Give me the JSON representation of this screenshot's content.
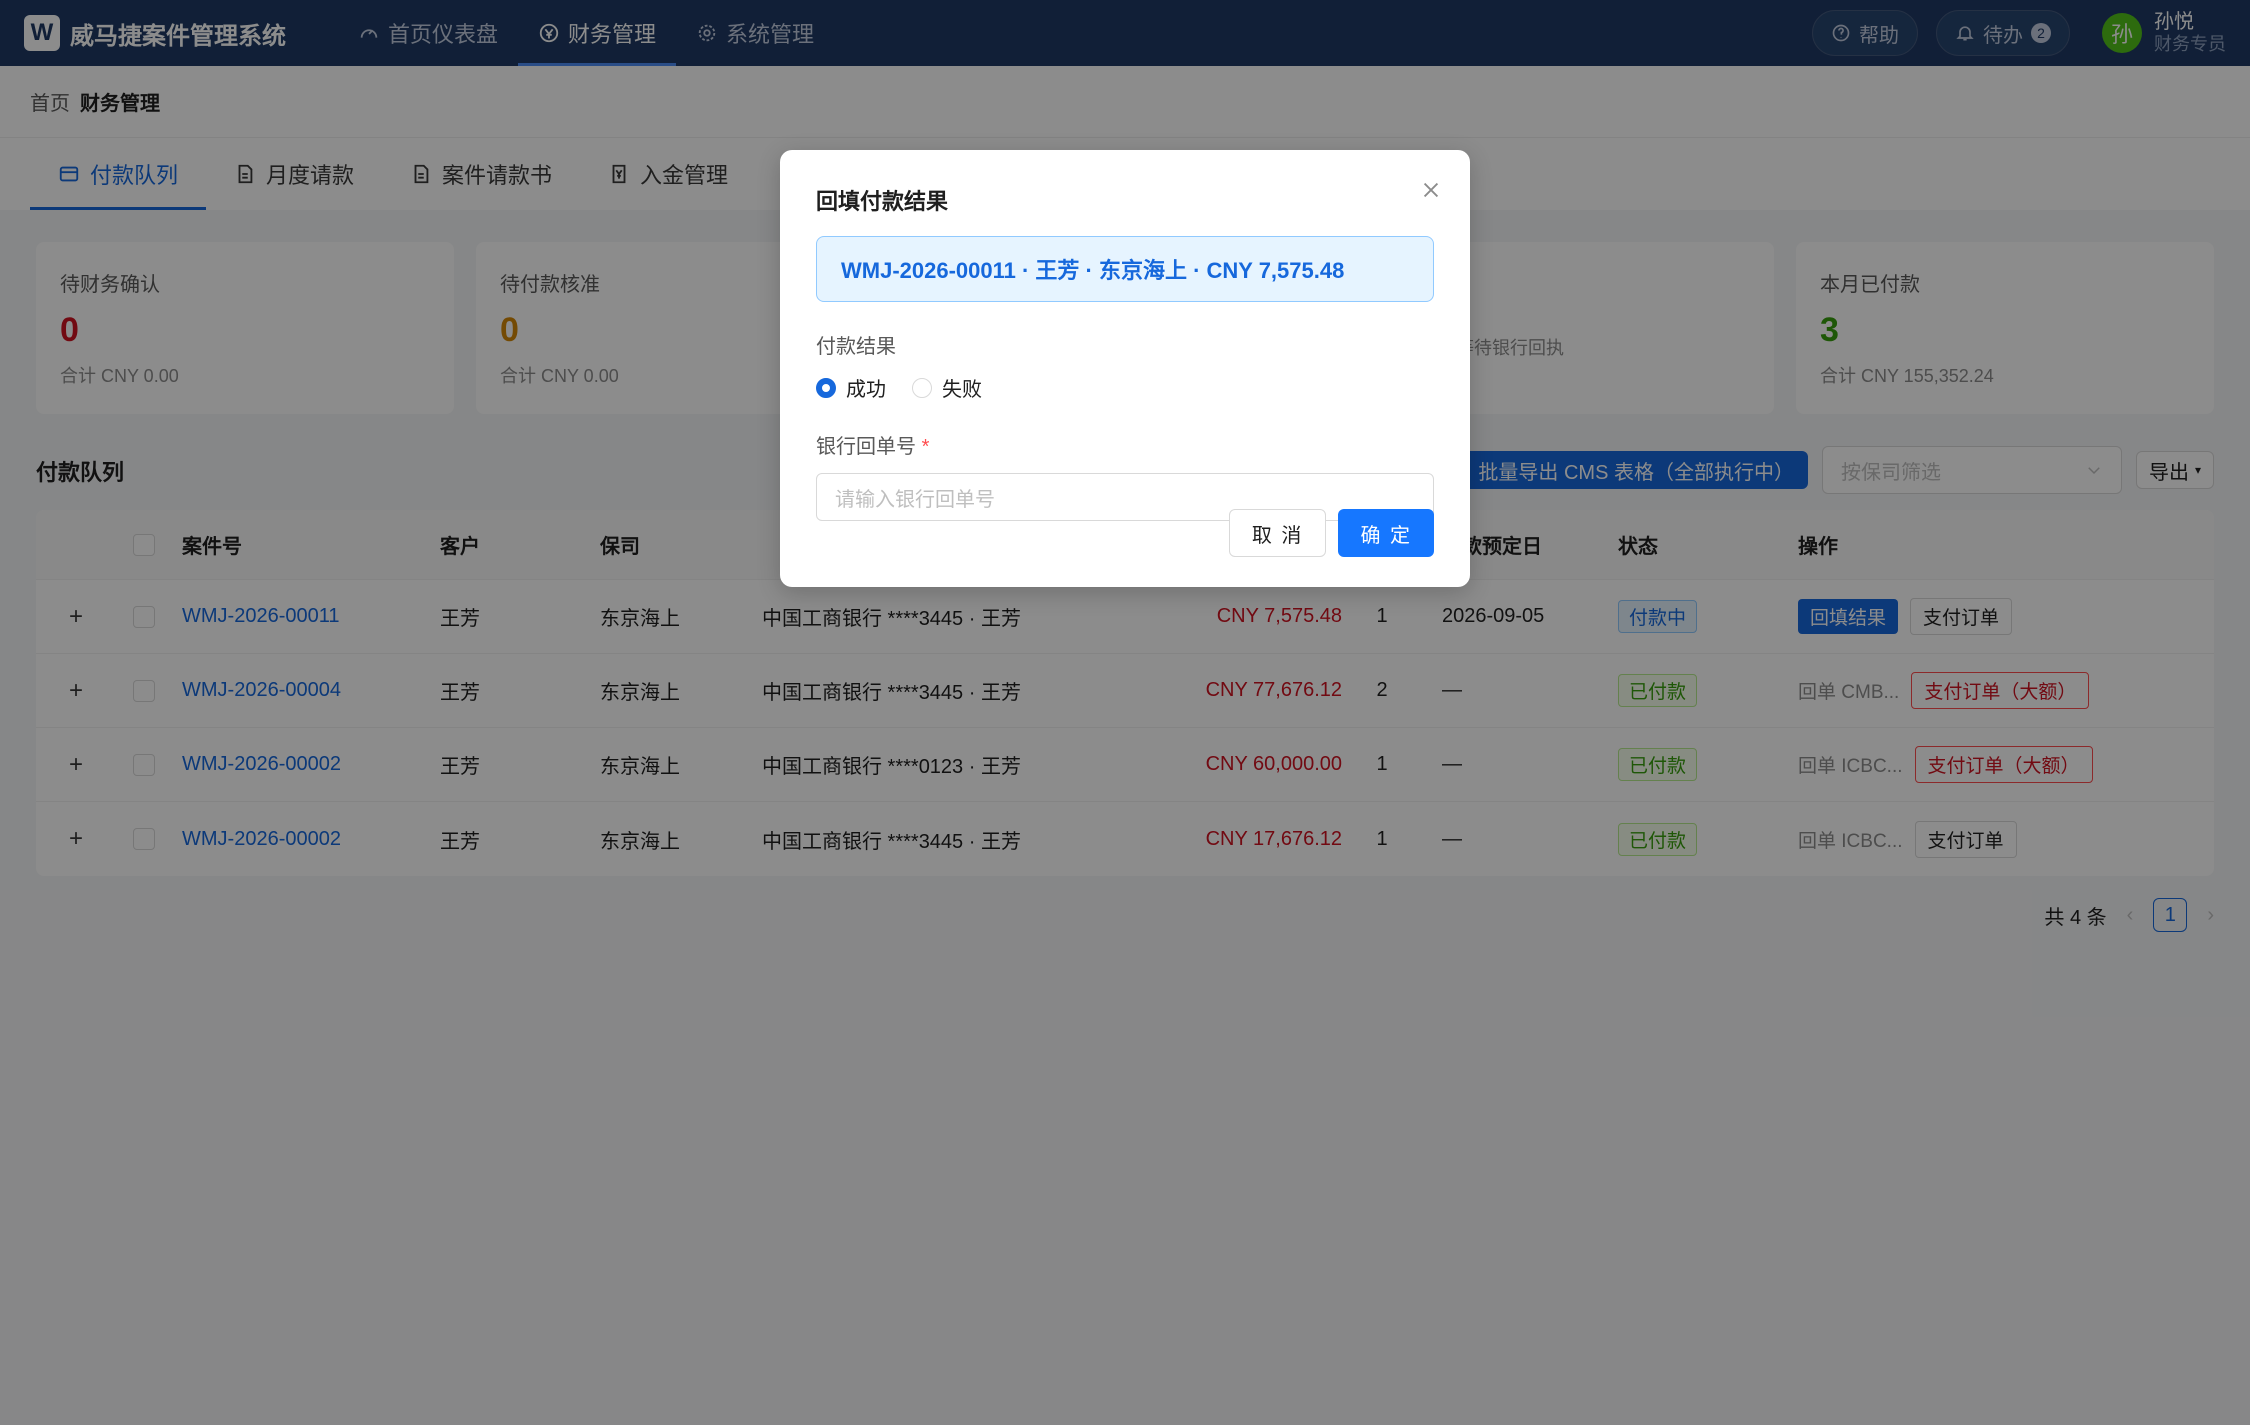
{
  "app": {
    "logo_letter": "W",
    "title": "威马捷案件管理系统"
  },
  "nav": [
    {
      "label": "首页仪表盘",
      "icon": "dashboard-icon"
    },
    {
      "label": "财务管理",
      "icon": "finance-icon"
    },
    {
      "label": "系统管理",
      "icon": "gear-icon"
    }
  ],
  "topbar": {
    "help": "帮助",
    "todo": "待办",
    "todo_count": "2"
  },
  "user": {
    "avatar": "孙",
    "name": "孙悦",
    "role": "财务专员"
  },
  "breadcrumb": {
    "home": "首页",
    "current": "财务管理"
  },
  "subtabs": [
    "付款队列",
    "月度请款",
    "案件请款书",
    "入金管理"
  ],
  "stats": [
    {
      "label": "待财务确认",
      "value": "0",
      "sub": "合计 CNY 0.00",
      "color": "#cf1322"
    },
    {
      "label": "待付款核准",
      "value": "0",
      "sub": "合计 CNY 0.00",
      "color": "#d48806"
    },
    {
      "label": "",
      "value": "",
      "sub": "",
      "color": "#1668dc"
    },
    {
      "label": "",
      "value": "",
      "sub": ",575.48 · 等待银行回执",
      "color": "#1668dc"
    },
    {
      "label": "本月已付款",
      "value": "3",
      "sub": "合计 CNY 155,352.24",
      "color": "#389e0d"
    }
  ],
  "section": {
    "title": "付款队列"
  },
  "toolbar": {
    "export_cms": "批量导出 CMS 表格（全部执行中）",
    "filter_placeholder": "按保司筛选",
    "export": "导出"
  },
  "table": {
    "headers": [
      "案件号",
      "客户",
      "保司",
      "",
      "",
      "",
      "付款预定日",
      "状态",
      "操作"
    ],
    "rows": [
      {
        "case": "WMJ-2026-00011",
        "client": "王芳",
        "insurer": "东京海上",
        "account": "中国工商银行 ****3445 · 王芳",
        "amount": "CNY 7,575.48",
        "count": "1",
        "date": "2026-09-05",
        "status": "付款中",
        "op1": "回填结果",
        "op2": "支付订单",
        "note": ""
      },
      {
        "case": "WMJ-2026-00004",
        "client": "王芳",
        "insurer": "东京海上",
        "account": "中国工商银行 ****3445 · 王芳",
        "amount": "CNY 77,676.12",
        "count": "2",
        "date": "—",
        "status": "已付款",
        "op1": "",
        "op2": "支付订单（大额）",
        "note": "回单 CMB..."
      },
      {
        "case": "WMJ-2026-00002",
        "client": "王芳",
        "insurer": "东京海上",
        "account": "中国工商银行 ****0123 · 王芳",
        "amount": "CNY 60,000.00",
        "count": "1",
        "date": "—",
        "status": "已付款",
        "op1": "",
        "op2": "支付订单（大额）",
        "note": "回单 ICBC..."
      },
      {
        "case": "WMJ-2026-00002",
        "client": "王芳",
        "insurer": "东京海上",
        "account": "中国工商银行 ****3445 · 王芳",
        "amount": "CNY 17,676.12",
        "count": "1",
        "date": "—",
        "status": "已付款",
        "op1": "",
        "op2": "支付订单",
        "note": "回单 ICBC..."
      }
    ]
  },
  "pager": {
    "total": "共 4 条",
    "page": "1"
  },
  "modal": {
    "title": "回填付款结果",
    "info": "WMJ-2026-00011 · 王芳 · 东京海上 · CNY 7,575.48",
    "result_label": "付款结果",
    "option_success": "成功",
    "option_fail": "失败",
    "receipt_label": "银行回单号",
    "receipt_required": "*",
    "receipt_placeholder": "请输入银行回单号",
    "cancel": "取 消",
    "ok": "确 定"
  }
}
